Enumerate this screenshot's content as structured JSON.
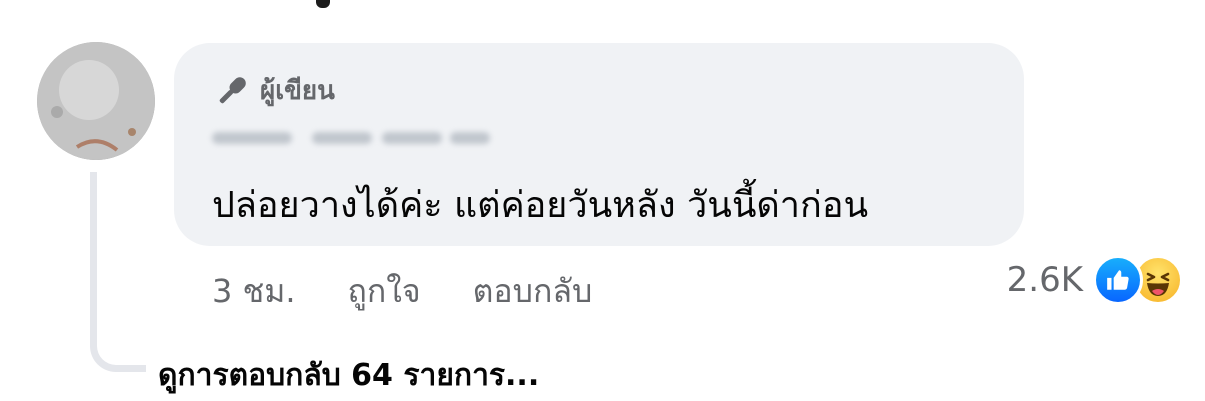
{
  "comment": {
    "author_badge": "ผู้เขียน",
    "author_name": "",
    "text": "ปล่อยวางได้ค่ะ แต่ค่อยวันหลัง วันนี้ด่าก่อน",
    "time": "3 ชม.",
    "like_label": "ถูกใจ",
    "reply_label": "ตอบกลับ",
    "reaction_count": "2.6K",
    "reaction_icons": [
      "like-icon",
      "haha-icon"
    ]
  },
  "replies": {
    "view_label": "ดูการตอบกลับ 64 รายการ..."
  },
  "colors": {
    "bubble": "#f0f2f5",
    "meta_text": "#65676b",
    "like_blue": "#0866ff",
    "haha_yellow": "#f7b125"
  }
}
